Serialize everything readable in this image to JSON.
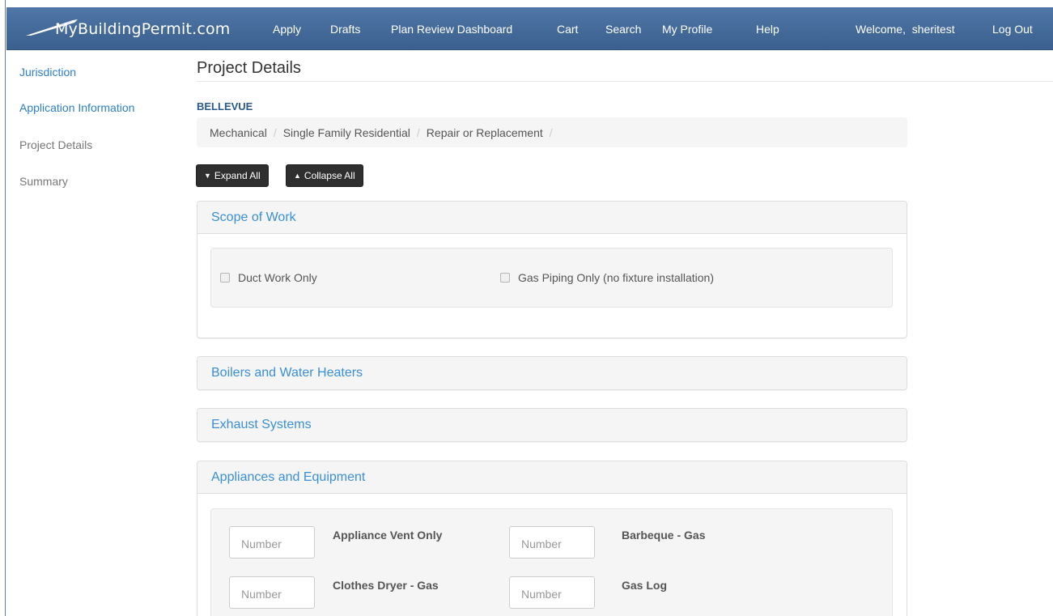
{
  "brand": {
    "name": "MyBuildingPermit.com"
  },
  "nav": {
    "apply": "Apply",
    "drafts": "Drafts",
    "plan_review": "Plan Review Dashboard",
    "cart": "Cart",
    "search": "Search",
    "my_profile": "My Profile",
    "help": "Help",
    "welcome": "Welcome,  sheritest",
    "logout": "Log Out"
  },
  "sidebar": {
    "items": [
      {
        "label": "Jurisdiction",
        "state": "link"
      },
      {
        "label": "Application Information",
        "state": "link"
      },
      {
        "label": "Project Details",
        "state": "current"
      },
      {
        "label": "Summary",
        "state": "disabled"
      }
    ]
  },
  "main": {
    "title": "Project Details",
    "jurisdiction": "BELLEVUE",
    "breadcrumb": [
      "Mechanical",
      "Single Family Residential",
      "Repair or Replacement"
    ],
    "breadcrumb_separator": "/",
    "expand_all": "Expand All",
    "collapse_all": "Collapse All"
  },
  "panels": {
    "scope": {
      "title": "Scope of Work",
      "options": [
        "Duct Work Only",
        "Gas Piping Only (no fixture installation)"
      ]
    },
    "boilers": {
      "title": "Boilers and Water Heaters"
    },
    "exhaust": {
      "title": "Exhaust Systems"
    },
    "appliances": {
      "title": "Appliances and Equipment",
      "placeholder": "Number",
      "fields": [
        "Appliance Vent Only",
        "Barbeque - Gas",
        "Clothes Dryer - Gas",
        "Gas Log"
      ]
    }
  },
  "colors": {
    "navbar": "#4a6f9f",
    "link": "#2e7fc9",
    "panel_title": "#3a8fd6",
    "jurisdiction": "#2b5a8c",
    "dark_button": "#2f2f2f"
  },
  "icons": {
    "expand": "chevron-down-icon",
    "collapse": "chevron-up-icon",
    "brand": "roof-logo-icon"
  }
}
